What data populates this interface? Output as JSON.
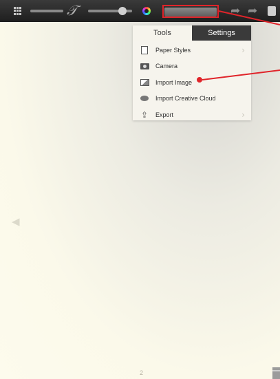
{
  "toolbar": {
    "icons": [
      "grid-icon",
      "brush-icon",
      "pen-icon",
      "color-wheel-icon",
      "undo-icon",
      "redo-icon",
      "tool-icon"
    ]
  },
  "panel": {
    "tabs": [
      {
        "label": "Tools"
      },
      {
        "label": "Settings"
      }
    ],
    "items": [
      {
        "label": "Paper Styles",
        "icon": "paper-icon"
      },
      {
        "label": "Camera",
        "icon": "camera-icon"
      },
      {
        "label": "Import Image",
        "icon": "image-icon"
      },
      {
        "label": "Import Creative Cloud",
        "icon": "creative-cloud-icon"
      },
      {
        "label": "Export",
        "icon": "export-icon"
      }
    ]
  },
  "canvas": {
    "page_number": "2"
  },
  "annotation": {
    "color": "#e0242a"
  }
}
